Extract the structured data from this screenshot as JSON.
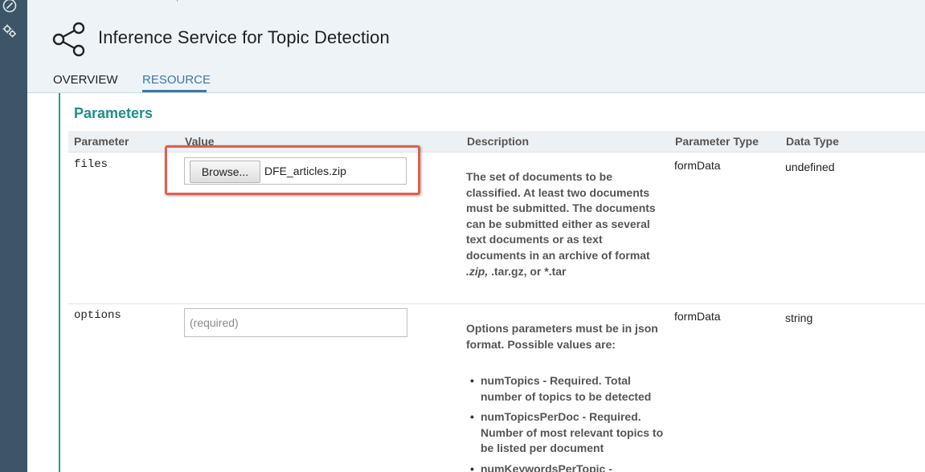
{
  "rail": {
    "icons": [
      "compass-icon",
      "gears-icon"
    ]
  },
  "header": {
    "title": "Inference Service for Topic Detection",
    "icon": "share-nodes-icon"
  },
  "tabs": [
    {
      "label": "OVERVIEW",
      "active": false
    },
    {
      "label": "RESOURCE",
      "active": true
    }
  ],
  "section": {
    "title": "Parameters"
  },
  "table": {
    "headers": [
      "Parameter",
      "Value",
      "Description",
      "Parameter Type",
      "Data Type"
    ],
    "rows": [
      {
        "name": "files",
        "browse_label": "Browse...",
        "file_name": "DFE_articles.zip",
        "description_lines": [
          "The set of documents to be",
          "classified. At least two documents",
          "must be submitted. The documents",
          "can be submitted either as several",
          "text documents or as text",
          "documents in an archive of format"
        ],
        "description_fmt_italic": ".zip,",
        "description_fmt_rest": " .tar.gz, or *.tar",
        "param_type": "formData",
        "data_type": "undefined"
      },
      {
        "name": "options",
        "placeholder": "(required)",
        "description_lines": [
          "Options parameters must be in json",
          "format. Possible values are:"
        ],
        "bullets": [
          [
            "numTopics - Required. Total",
            "number of topics to be detected"
          ],
          [
            "numTopicsPerDoc - Required.",
            "Number of most relevant topics to",
            "be listed per document"
          ],
          [
            "numKeywordsPerTopic -"
          ]
        ],
        "param_type": "formData",
        "data_type": "string"
      }
    ]
  },
  "colors": {
    "rail": "#3d5566",
    "header_bg": "#eef3f8",
    "accent_teal": "#1e8f89",
    "tab_active": "#3b78a8",
    "highlight": "#e0604f"
  }
}
